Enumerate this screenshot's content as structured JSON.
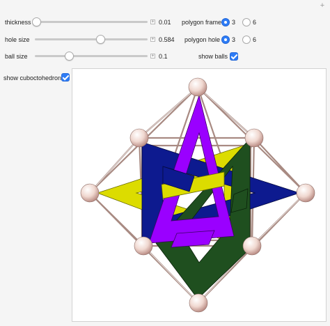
{
  "controls": {
    "thickness": {
      "label": "thickness",
      "value": "0.01",
      "fraction": 0.02
    },
    "hole_size": {
      "label": "hole size",
      "value": "0.584",
      "fraction": 0.58
    },
    "ball_size": {
      "label": "ball size",
      "value": "0.1",
      "fraction": 0.31
    }
  },
  "polygon_frame": {
    "label": "polygon frame",
    "options": [
      "3",
      "6"
    ],
    "selected": "3"
  },
  "polygon_hole": {
    "label": "polygon hole",
    "options": [
      "3",
      "6"
    ],
    "selected": "3"
  },
  "show_balls": {
    "label": "show balls",
    "checked": true
  },
  "show_cuboctohedron": {
    "label": "show cuboctohedron",
    "checked": true
  },
  "colors": {
    "accent": "#2e7cf6",
    "purple": "#9a00ff",
    "navy": "#0d1a8f",
    "green": "#1f4f1f",
    "yellow": "#dcdc00"
  }
}
